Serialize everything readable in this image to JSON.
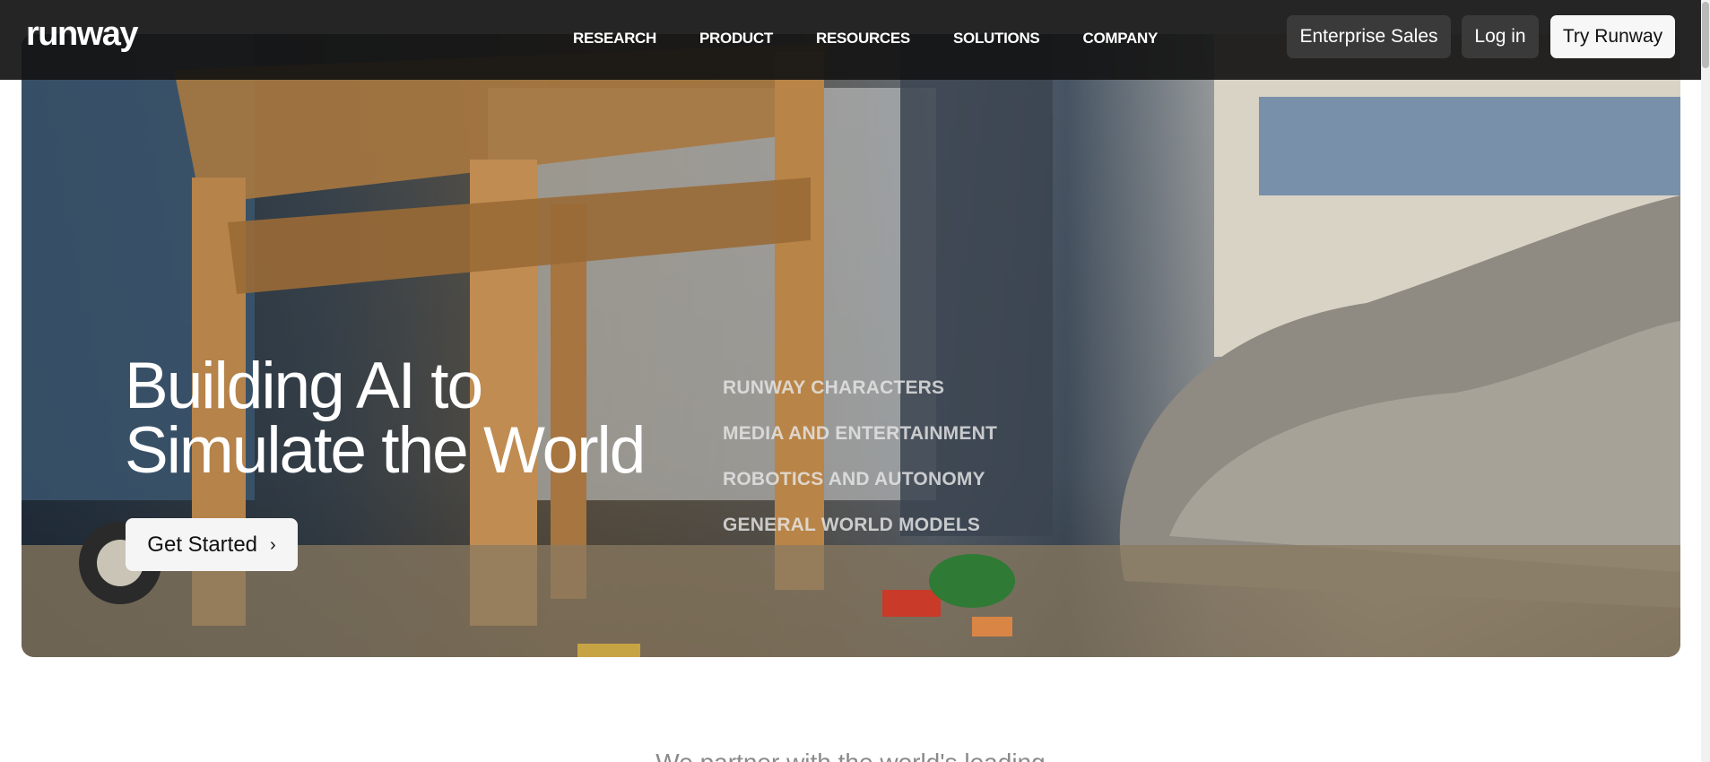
{
  "header": {
    "logo": "runway",
    "nav": [
      "RESEARCH",
      "PRODUCT",
      "RESOURCES",
      "SOLUTIONS",
      "COMPANY"
    ],
    "enterprise_label": "Enterprise Sales",
    "login_label": "Log in",
    "try_label": "Try Runway"
  },
  "hero": {
    "title_line1": "Building AI to",
    "title_line2": "Simulate the World",
    "cta_label": "Get Started",
    "cta_icon": "chevron-right-icon",
    "categories": [
      "RUNWAY CHARACTERS",
      "MEDIA AND ENTERTAINMENT",
      "ROBOTICS AND AUTONOMY",
      "GENERAL WORLD MODELS"
    ]
  },
  "partner_text": "We partner with the world's leading",
  "colors": {
    "header_bg": "#141414",
    "button_dark": "#3a3a3a",
    "button_light": "#f7f7f7"
  }
}
